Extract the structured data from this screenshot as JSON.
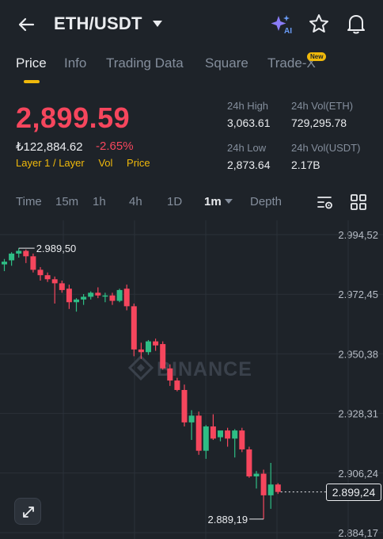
{
  "header": {
    "pair": "ETH/USDT",
    "icons": {
      "back": "back-arrow-icon",
      "ai": "ai-sparkle-icon",
      "favorite": "star-icon",
      "alerts": "bell-icon"
    },
    "ai_label": "AI"
  },
  "tabs": [
    {
      "label": "Price",
      "active": true
    },
    {
      "label": "Info",
      "active": false
    },
    {
      "label": "Trading Data",
      "active": false
    },
    {
      "label": "Square",
      "active": false
    },
    {
      "label": "Trade-X",
      "active": false,
      "badge": "New"
    }
  ],
  "ticker": {
    "last_price": "2,899.59",
    "fiat_price": "₺122,884.62",
    "change_pct": "-2.65%",
    "tags": [
      "Layer 1 / Layer",
      "Vol",
      "Price"
    ],
    "high_label": "24h High",
    "high_value": "3,063.61",
    "low_label": "24h Low",
    "low_value": "2,873.64",
    "vol_eth_label": "24h Vol(ETH)",
    "vol_eth_value": "729,295.78",
    "vol_usdt_label": "24h Vol(USDT)",
    "vol_usdt_value": "2.17B"
  },
  "intervals": {
    "items": [
      "Time",
      "15m",
      "1h",
      "4h",
      "1D",
      "1m",
      "Depth"
    ],
    "active": "1m"
  },
  "chart_data": {
    "type": "candlestick",
    "watermark": "BINANCE",
    "y_ticks": [
      "2.994,52",
      "2.972,45",
      "2.950,38",
      "2.928,31",
      "2.906,24",
      "2.884,17"
    ],
    "ylim": [
      2884.17,
      2994.52
    ],
    "high_marker": "2.989,50",
    "low_marker": "2.889,19",
    "current_price": "2.899,24",
    "colors": {
      "up": "#2ebd85",
      "down": "#f6465d",
      "grid": "#2b3139",
      "axis_text": "#b7bdc6"
    },
    "candles": [
      {
        "o": 2983.5,
        "h": 2985.5,
        "l": 2981.0,
        "c": 2984.5
      },
      {
        "o": 2985.0,
        "h": 2988.0,
        "l": 2983.0,
        "c": 2987.5
      },
      {
        "o": 2987.5,
        "h": 2989.5,
        "l": 2986.0,
        "c": 2988.5
      },
      {
        "o": 2988.5,
        "h": 2989.0,
        "l": 2984.0,
        "c": 2986.5
      },
      {
        "o": 2986.5,
        "h": 2987.5,
        "l": 2980.5,
        "c": 2981.5
      },
      {
        "o": 2981.5,
        "h": 2982.5,
        "l": 2977.5,
        "c": 2979.5
      },
      {
        "o": 2979.5,
        "h": 2980.5,
        "l": 2977.0,
        "c": 2978.0
      },
      {
        "o": 2978.0,
        "h": 2979.0,
        "l": 2969.0,
        "c": 2976.5
      },
      {
        "o": 2976.5,
        "h": 2977.5,
        "l": 2973.0,
        "c": 2974.0
      },
      {
        "o": 2974.5,
        "h": 2976.0,
        "l": 2967.0,
        "c": 2969.5
      },
      {
        "o": 2969.5,
        "h": 2971.0,
        "l": 2966.0,
        "c": 2970.5
      },
      {
        "o": 2970.5,
        "h": 2972.5,
        "l": 2968.5,
        "c": 2971.5
      },
      {
        "o": 2971.5,
        "h": 2973.5,
        "l": 2970.5,
        "c": 2973.0
      },
      {
        "o": 2973.0,
        "h": 2975.0,
        "l": 2971.0,
        "c": 2972.0
      },
      {
        "o": 2972.0,
        "h": 2973.0,
        "l": 2969.5,
        "c": 2972.0
      },
      {
        "o": 2972.0,
        "h": 2973.0,
        "l": 2968.5,
        "c": 2970.0
      },
      {
        "o": 2970.0,
        "h": 2974.5,
        "l": 2969.5,
        "c": 2974.0
      },
      {
        "o": 2974.5,
        "h": 2976.0,
        "l": 2966.5,
        "c": 2968.0
      },
      {
        "o": 2968.0,
        "h": 2969.0,
        "l": 2949.5,
        "c": 2952.0
      },
      {
        "o": 2952.0,
        "h": 2954.5,
        "l": 2948.5,
        "c": 2951.0
      },
      {
        "o": 2951.0,
        "h": 2955.5,
        "l": 2950.0,
        "c": 2955.0
      },
      {
        "o": 2955.0,
        "h": 2956.0,
        "l": 2951.5,
        "c": 2953.5
      },
      {
        "o": 2954.0,
        "h": 2955.0,
        "l": 2944.5,
        "c": 2945.0
      },
      {
        "o": 2945.0,
        "h": 2946.5,
        "l": 2938.5,
        "c": 2940.5
      },
      {
        "o": 2940.5,
        "h": 2941.5,
        "l": 2936.5,
        "c": 2937.0
      },
      {
        "o": 2937.0,
        "h": 2939.0,
        "l": 2923.5,
        "c": 2925.0
      },
      {
        "o": 2925.0,
        "h": 2929.5,
        "l": 2918.5,
        "c": 2927.5
      },
      {
        "o": 2927.5,
        "h": 2929.0,
        "l": 2913.0,
        "c": 2914.5
      },
      {
        "o": 2914.5,
        "h": 2924.0,
        "l": 2911.5,
        "c": 2923.5
      },
      {
        "o": 2923.5,
        "h": 2928.0,
        "l": 2918.5,
        "c": 2919.0
      },
      {
        "o": 2919.5,
        "h": 2920.5,
        "l": 2918.0,
        "c": 2922.0
      },
      {
        "o": 2922.0,
        "h": 2923.0,
        "l": 2916.0,
        "c": 2919.0
      },
      {
        "o": 2919.0,
        "h": 2922.5,
        "l": 2912.0,
        "c": 2922.0
      },
      {
        "o": 2922.0,
        "h": 2923.0,
        "l": 2914.0,
        "c": 2915.0
      },
      {
        "o": 2915.0,
        "h": 2916.0,
        "l": 2904.5,
        "c": 2905.0
      },
      {
        "o": 2905.0,
        "h": 2907.0,
        "l": 2900.5,
        "c": 2906.0
      },
      {
        "o": 2906.0,
        "h": 2907.5,
        "l": 2889.19,
        "c": 2898.0
      },
      {
        "o": 2898.0,
        "h": 2910.0,
        "l": 2893.0,
        "c": 2902.0
      },
      {
        "o": 2902.0,
        "h": 2902.5,
        "l": 2898.5,
        "c": 2899.24
      }
    ]
  }
}
